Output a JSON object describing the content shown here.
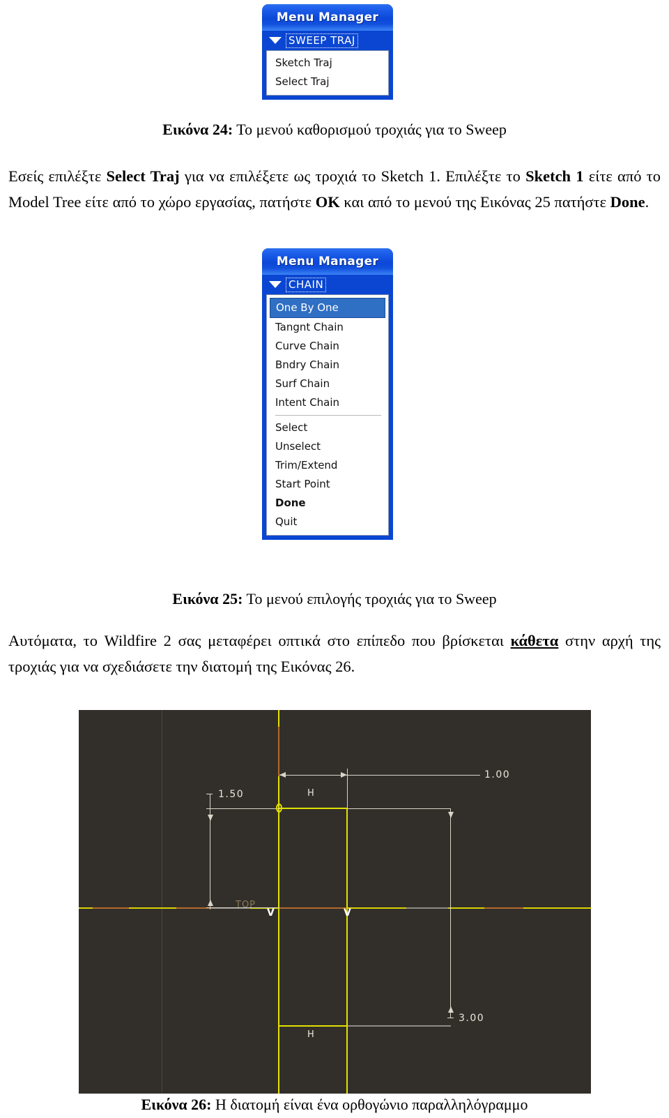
{
  "menu24": {
    "title": "Menu Manager",
    "header": "SWEEP TRAJ",
    "items": [
      {
        "label": "Sketch Traj",
        "selected": false,
        "bold": false
      },
      {
        "label": "Select Traj",
        "selected": false,
        "bold": false
      }
    ]
  },
  "caption24": {
    "prefix": "Εικόνα 24:",
    "text": " Το μενού καθορισμού τροχιάς για το Sweep"
  },
  "paragraph1": {
    "line1_a": "Εσείς επιλέξτε ",
    "line1_b": "Select Traj",
    "line1_c": " για να επιλέξετε ως τροχιά το Sketch 1. Επιλέξτε το ",
    "line2_a": "Sketch 1",
    "line2_b": " είτε από το Model Tree είτε από το χώρο εργασίας, πατήστε ",
    "line2_c": "OK",
    "line2_d": " και από το μενού της Εικόνας 25 πατήστε ",
    "line3_a": "Done",
    "line3_b": "."
  },
  "menu25": {
    "title": "Menu Manager",
    "header": "CHAIN",
    "items": [
      {
        "label": "One By One",
        "selected": true,
        "bold": false
      },
      {
        "label": "Tangnt Chain",
        "selected": false,
        "bold": false
      },
      {
        "label": "Curve Chain",
        "selected": false,
        "bold": false
      },
      {
        "label": "Bndry Chain",
        "selected": false,
        "bold": false
      },
      {
        "label": "Surf Chain",
        "selected": false,
        "bold": false
      },
      {
        "label": "Intent Chain",
        "selected": false,
        "bold": false
      },
      {
        "label": "Select",
        "selected": false,
        "bold": false,
        "sep_before": true
      },
      {
        "label": "Unselect",
        "selected": false,
        "bold": false
      },
      {
        "label": "Trim/Extend",
        "selected": false,
        "bold": false
      },
      {
        "label": "Start Point",
        "selected": false,
        "bold": false
      },
      {
        "label": "Done",
        "selected": false,
        "bold": true
      },
      {
        "label": "Quit",
        "selected": false,
        "bold": false
      }
    ]
  },
  "caption25": {
    "prefix": "Εικόνα 25:",
    "text": " Το μενού επιλογής τροχιάς για το Sweep"
  },
  "paragraph2": {
    "line1_a": "Αυτόματα, το Wildfire 2 σας μεταφέρει οπτικά στο επίπεδο που βρίσκεται ",
    "line1_b": "κάθετα",
    "line2_a": "στην αρχή της τροχιάς για να σχεδιάσετε την διατομή της Εικόνας 26."
  },
  "cad": {
    "dim_150": "1.50",
    "dim_100": "1.00",
    "dim_300": "3.00",
    "label_h_top": "H",
    "label_h_bottom": "H",
    "label_top_plane": "TOP",
    "vmark_left": "V",
    "vmark_right": "V",
    "background_color": "#322f2b",
    "sketch_color": "#e3e000",
    "dimension_color": "#d8d6c8"
  },
  "caption26": {
    "prefix": "Εικόνα 26:",
    "text": " Η διατομή είναι ένα ορθογώνιο παραλληλόγραμμο"
  }
}
